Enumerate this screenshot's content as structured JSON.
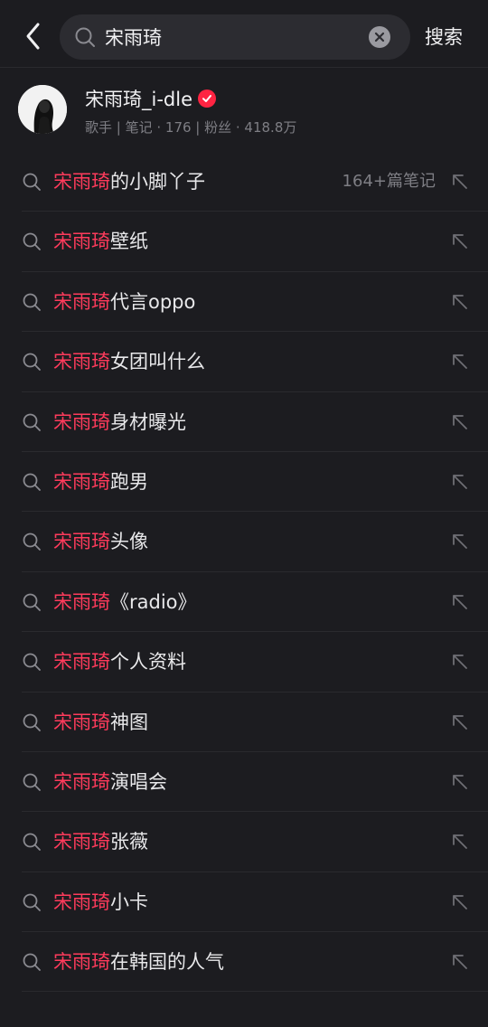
{
  "search": {
    "query": "宋雨琦",
    "action_label": "搜索"
  },
  "profile": {
    "name": "宋雨琦_i-dle",
    "meta": "歌手 | 笔记 · 176 | 粉丝 · 418.8万"
  },
  "suggestions": [
    {
      "highlight": "宋雨琦",
      "rest": "的小脚丫子",
      "count": "164+篇笔记"
    },
    {
      "highlight": "宋雨琦",
      "rest": "壁纸"
    },
    {
      "highlight": "宋雨琦",
      "rest": "代言oppo"
    },
    {
      "highlight": "宋雨琦",
      "rest": "女团叫什么"
    },
    {
      "highlight": "宋雨琦",
      "rest": "身材曝光"
    },
    {
      "highlight": "宋雨琦",
      "rest": "跑男"
    },
    {
      "highlight": "宋雨琦",
      "rest": "头像"
    },
    {
      "highlight": "宋雨琦",
      "rest": "《radio》"
    },
    {
      "highlight": "宋雨琦",
      "rest": "个人资料"
    },
    {
      "highlight": "宋雨琦",
      "rest": "神图"
    },
    {
      "highlight": "宋雨琦",
      "rest": "演唱会"
    },
    {
      "highlight": "宋雨琦",
      "rest": "张薇"
    },
    {
      "highlight": "宋雨琦",
      "rest": "小卡"
    },
    {
      "highlight": "宋雨琦",
      "rest": "在韩国的人气"
    }
  ],
  "colors": {
    "background": "#1c1c20",
    "highlight": "#ff3b5c",
    "verified_badge": "#ff2442"
  },
  "icons": {
    "back": "chevron-left-icon",
    "search": "search-icon",
    "clear": "clear-icon",
    "verified": "verified-icon",
    "fill": "arrow-up-left-icon"
  }
}
